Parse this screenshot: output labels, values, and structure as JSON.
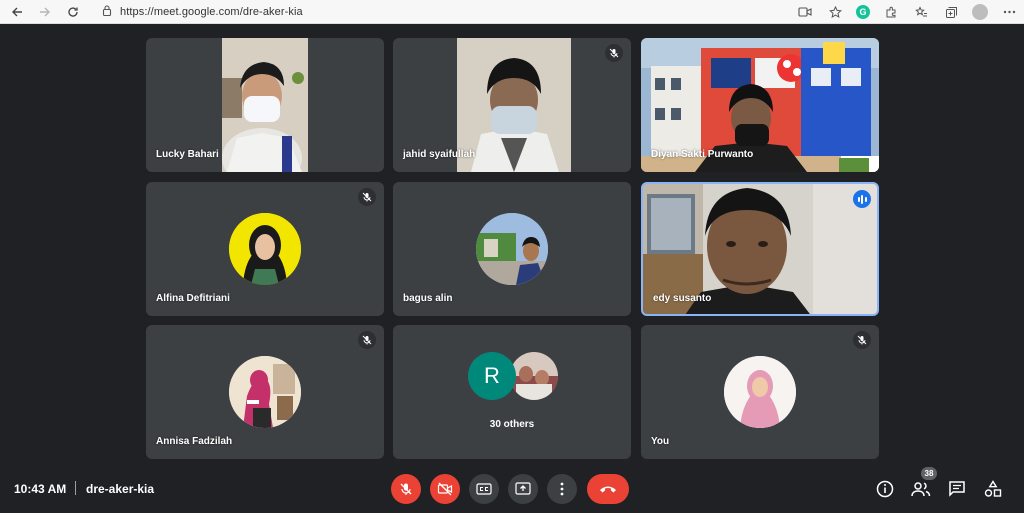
{
  "browser": {
    "url": "https://meet.google.com/dre-aker-kia",
    "grammarly_letter": "G"
  },
  "participants": [
    {
      "name": "Lucky Bahari",
      "muted": false
    },
    {
      "name": "jahid syaifullah",
      "muted": true
    },
    {
      "name": "Diyan Sakti Purwanto",
      "muted": false
    },
    {
      "name": "Alfina Defitriani",
      "muted": true
    },
    {
      "name": "bagus alin",
      "muted": false
    },
    {
      "name": "edy susanto",
      "muted": false,
      "speaking": true
    },
    {
      "name": "Annisa Fadzilah",
      "muted": true
    },
    {
      "name": "You",
      "muted": true
    }
  ],
  "others_tile": {
    "initial": "R",
    "label": "30 others"
  },
  "meeting": {
    "time": "10:43 AM",
    "code": "dre-aker-kia",
    "participant_count": "38"
  },
  "colors": {
    "background": "#202124",
    "tile": "#3c4043",
    "danger": "#ea4335",
    "active_border": "#8ab4f8",
    "speaking": "#1a73e8",
    "others_avatar": "#00897b"
  }
}
